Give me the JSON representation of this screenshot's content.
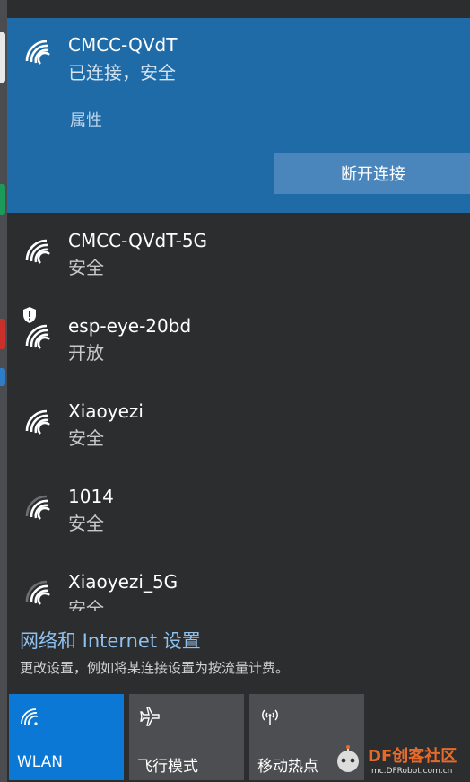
{
  "connected_network": {
    "name": "CMCC-QVdT",
    "status": "已连接，安全",
    "properties_link": "属性",
    "disconnect_button": "断开连接",
    "icon": "wifi-signal-full-icon"
  },
  "networks": [
    {
      "name": "CMCC-QVdT-5G",
      "status": "安全",
      "icon": "wifi-signal-full-icon"
    },
    {
      "name": "esp-eye-20bd",
      "status": "开放",
      "icon": "wifi-signal-open-shield-icon"
    },
    {
      "name": "Xiaoyezi",
      "status": "安全",
      "icon": "wifi-signal-full-icon"
    },
    {
      "name": "1014",
      "status": "安全",
      "icon": "wifi-signal-medium-icon"
    },
    {
      "name": "Xiaoyezi_5G",
      "status": "安全",
      "icon": "wifi-signal-medium-icon"
    }
  ],
  "settings": {
    "link": "网络和 Internet 设置",
    "description": "更改设置，例如将某连接设置为按流量计费。"
  },
  "quick_actions": [
    {
      "label": "WLAN",
      "icon": "wifi-icon",
      "active": true
    },
    {
      "label": "飞行模式",
      "icon": "airplane-icon",
      "active": false
    },
    {
      "label": "移动热点",
      "icon": "hotspot-icon",
      "active": false
    }
  ],
  "watermark": {
    "brand": "DF创客社区",
    "url": "mc.DFRobot.com.cn"
  },
  "colors": {
    "panel_bg": "#2b2d2f",
    "connected_bg": "#1e6ba8",
    "active_tile": "#0a78d4",
    "inactive_tile": "#4c4e51",
    "link": "#8fc1ef"
  }
}
